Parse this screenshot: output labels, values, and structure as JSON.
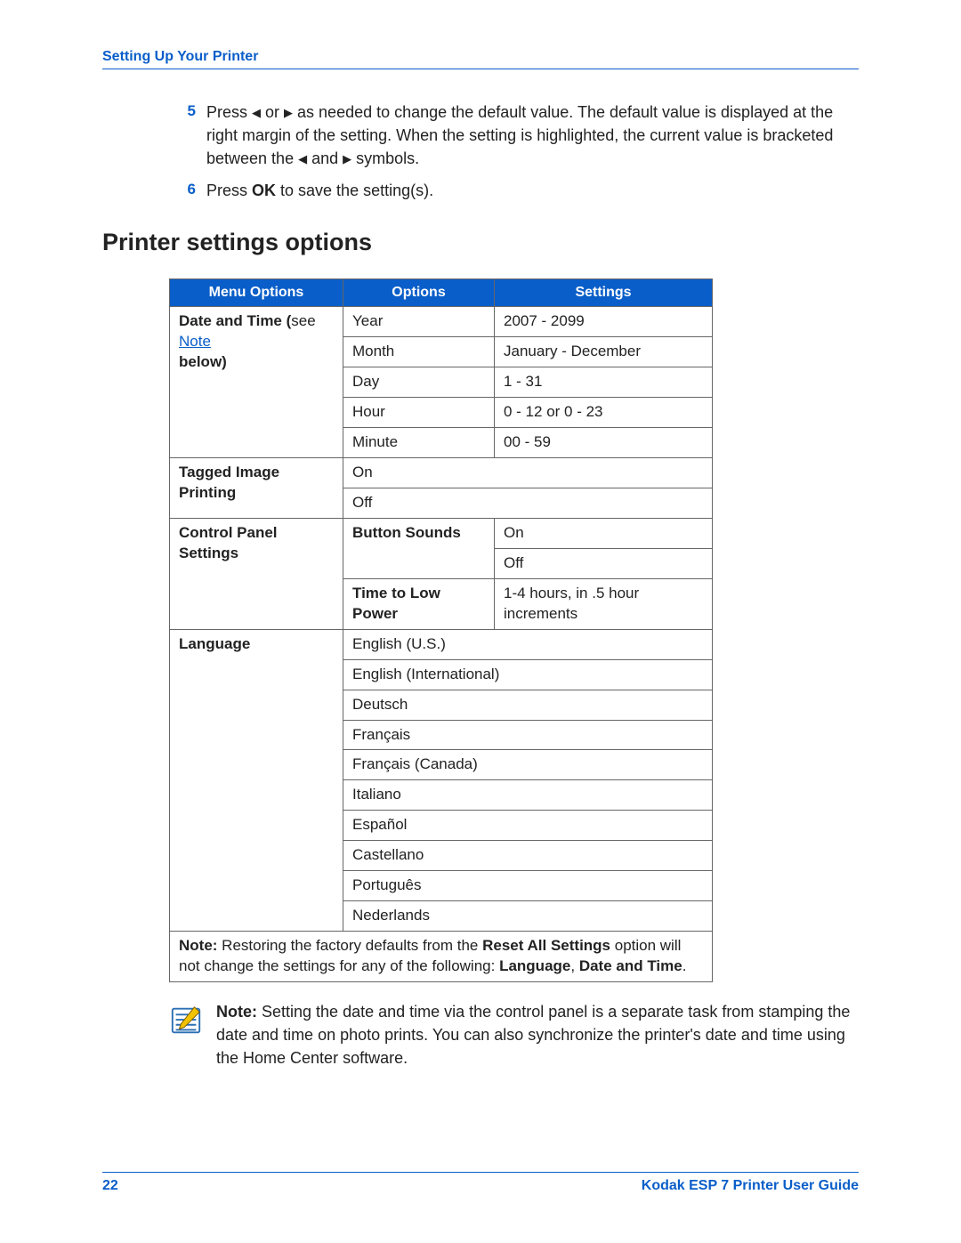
{
  "header": {
    "section": "Setting Up Your Printer"
  },
  "steps": [
    {
      "num": "5",
      "pre": "Press ",
      "mid": " or ",
      "post": " as needed to change the default value. The default value is displayed at the right margin of the setting. When the setting is highlighted, the current value is bracketed between the ",
      "mid2": " and ",
      "end": " symbols."
    },
    {
      "num": "6",
      "pre": "Press ",
      "bold": "OK",
      "post": " to save the setting(s)."
    }
  ],
  "section_title": "Printer settings options",
  "table": {
    "headers": [
      "Menu Options",
      "Options",
      "Settings"
    ],
    "menu_date_label": "Date and Time ",
    "menu_date_paren_open": "(",
    "menu_date_see": "see ",
    "menu_date_link": "Note",
    "menu_date_below": "below",
    "menu_date_paren_close": ")",
    "date_rows": [
      [
        "Year",
        "2007 - 2099"
      ],
      [
        "Month",
        "January - December"
      ],
      [
        "Day",
        "1 - 31"
      ],
      [
        "Hour",
        "0 - 12 or 0 - 23"
      ],
      [
        "Minute",
        "00 - 59"
      ]
    ],
    "menu_tagged": "Tagged Image Printing",
    "tagged_rows": [
      "On",
      "Off"
    ],
    "menu_cps": "Control Panel Settings",
    "cps_button_sounds": "Button Sounds",
    "cps_bs_rows": [
      "On",
      "Off"
    ],
    "cps_time_low": "Time to Low Power",
    "cps_time_low_val": "1-4 hours, in .5 hour increments",
    "menu_lang": "Language",
    "lang_rows": [
      "English (U.S.)",
      "English (International)",
      "Deutsch",
      "Français",
      "Français (Canada)",
      "Italiano",
      "Español",
      "Castellano",
      "Português",
      "Nederlands"
    ],
    "note_row": {
      "label": "Note:",
      "t1": "  Restoring the factory defaults from the ",
      "b1": "Reset All Settings",
      "t2": " option will not change the settings for any of the following: ",
      "b2": "Language",
      "comma": ", ",
      "b3": "Date and Time",
      "period": "."
    }
  },
  "note_block": {
    "label": "Note:",
    "text": "  Setting the date and time via the control panel is a separate task from stamping the date and time on photo prints. You can also synchronize the printer's date and time using the Home Center software."
  },
  "footer": {
    "page": "22",
    "guide": "Kodak ESP 7 Printer User Guide"
  }
}
